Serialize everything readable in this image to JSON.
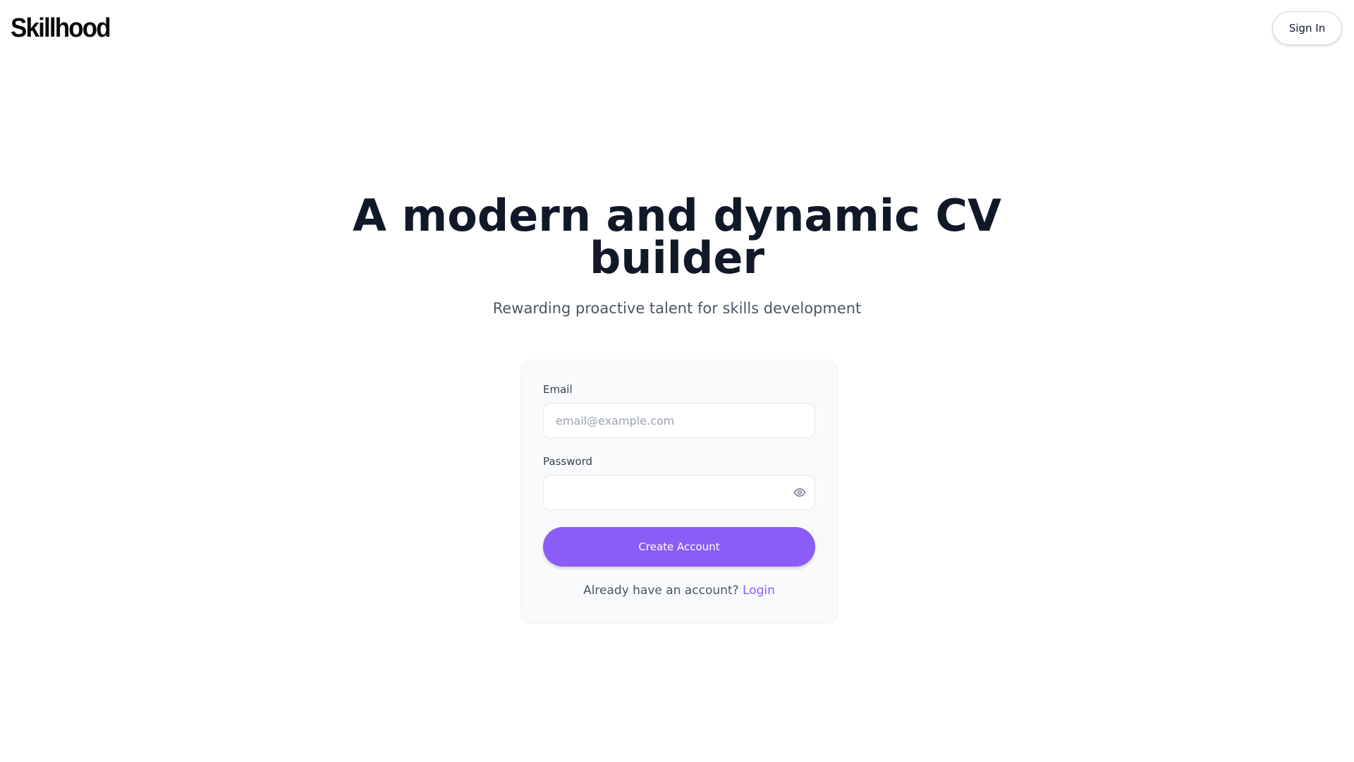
{
  "header": {
    "logo_text": "Skillhood",
    "signin_label": "Sign In"
  },
  "hero": {
    "title": "A modern and dynamic CV builder",
    "subtitle": "Rewarding proactive talent for skills development"
  },
  "form": {
    "email_label": "Email",
    "email_placeholder": "email@example.com",
    "email_value": "",
    "password_label": "Password",
    "password_value": "",
    "password_toggle_icon": "eye-icon",
    "submit_label": "Create Account",
    "login_prompt": "Already have an account?",
    "login_link": "Login"
  },
  "colors": {
    "accent": "#8b5cf6",
    "title": "#111827",
    "subtitle": "#4b5563",
    "card_bg": "#f9fafb"
  }
}
